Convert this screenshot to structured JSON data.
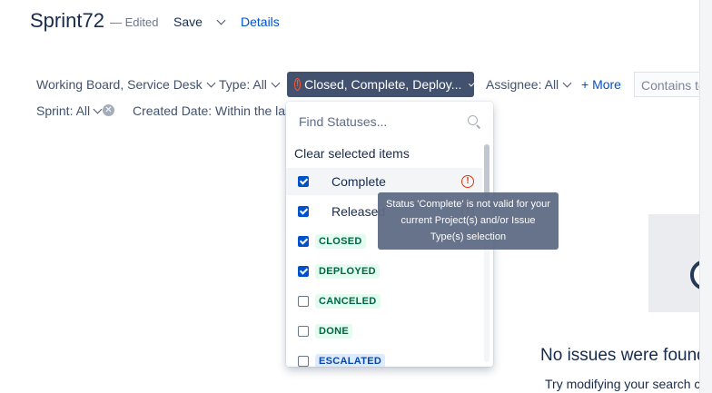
{
  "header": {
    "title": "Sprint72",
    "edited": "— Edited",
    "save_label": "Save",
    "details_label": "Details"
  },
  "filters": {
    "project": "Working Board, Service Desk",
    "type": "Type: All",
    "status": "Closed, Complete, Deploy...",
    "assignee": "Assignee: All",
    "more": "+ More",
    "contains_placeholder": "Contains text",
    "sprint": "Sprint: All",
    "created": "Created Date: Within the last"
  },
  "dropdown": {
    "search_placeholder": "Find Statuses...",
    "clear_label": "Clear selected items",
    "items": [
      {
        "label": "Complete",
        "checked": true,
        "style": "plain",
        "warning": true
      },
      {
        "label": "Released",
        "checked": true,
        "style": "plain",
        "warning": true
      },
      {
        "label": "CLOSED",
        "checked": true,
        "style": "green"
      },
      {
        "label": "DEPLOYED",
        "checked": true,
        "style": "green"
      },
      {
        "label": "CANCELED",
        "checked": false,
        "style": "green"
      },
      {
        "label": "DONE",
        "checked": false,
        "style": "green"
      },
      {
        "label": "ESCALATED",
        "checked": false,
        "style": "blue"
      }
    ]
  },
  "tooltip": {
    "text": "Status 'Complete' is not valid for your current Project(s) and/or Issue Type(s) selection"
  },
  "empty_state": {
    "title": "No issues were found",
    "subtitle": "Try modifying your search criteria"
  },
  "colors": {
    "accent": "#0052cc",
    "status_button": "#42526e",
    "warning": "#de350b"
  }
}
